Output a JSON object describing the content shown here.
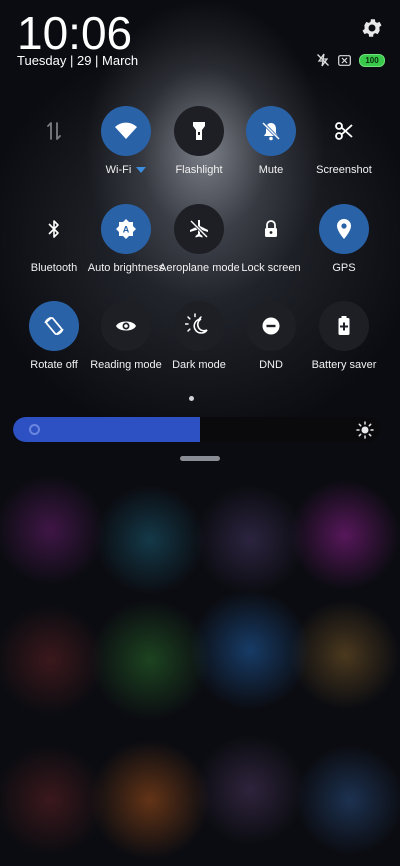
{
  "header": {
    "time": "10:06",
    "date": "Tuesday | 29 | March",
    "battery_level": "100",
    "icons": [
      "settings-icon",
      "no-charging-icon",
      "no-sim-icon",
      "battery-icon"
    ]
  },
  "tiles": [
    {
      "label": "",
      "active": false,
      "icon": "data-arrows-icon"
    },
    {
      "label": "Wi-Fi",
      "active": true,
      "icon": "wifi-icon"
    },
    {
      "label": "Flashlight",
      "active": false,
      "icon": "flashlight-icon"
    },
    {
      "label": "Mute",
      "active": true,
      "icon": "mute-bell-icon"
    },
    {
      "label": "Screenshot",
      "active": false,
      "icon": "scissors-icon"
    },
    {
      "label": "Bluetooth",
      "active": false,
      "icon": "bluetooth-icon"
    },
    {
      "label": "Auto brightness",
      "active": true,
      "icon": "auto-brightness-icon"
    },
    {
      "label": "Aeroplane mode",
      "active": false,
      "icon": "aeroplane-off-icon"
    },
    {
      "label": "Lock screen",
      "active": false,
      "icon": "lock-icon"
    },
    {
      "label": "GPS",
      "active": true,
      "icon": "location-pin-icon"
    },
    {
      "label": "Rotate off",
      "active": true,
      "icon": "rotate-icon"
    },
    {
      "label": "Reading mode",
      "active": false,
      "icon": "eye-icon"
    },
    {
      "label": "Dark mode",
      "active": false,
      "icon": "dark-mode-icon"
    },
    {
      "label": "DND",
      "active": false,
      "icon": "dnd-icon"
    },
    {
      "label": "Battery saver",
      "active": false,
      "icon": "battery-saver-icon"
    }
  ],
  "brightness": {
    "level_percent": 51
  },
  "colors": {
    "active": "#2a62a8",
    "inactive": "#1d1f24",
    "slider": "#2d51c2",
    "battery": "#39c94b"
  }
}
